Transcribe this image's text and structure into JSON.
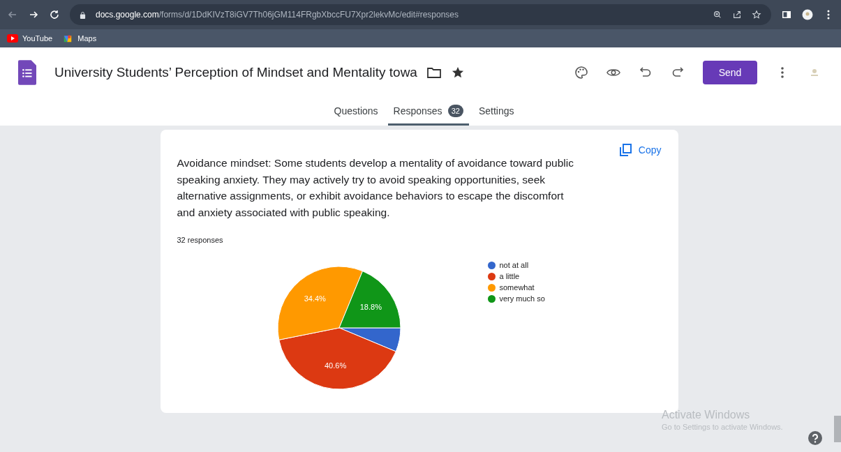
{
  "browser": {
    "url_host": "docs.google.com",
    "url_path": "/forms/d/1DdKIVzT8iGV7Th06jGM114FRgbXbccFU7Xpr2lekvMc/edit#responses"
  },
  "bookmarks": [
    {
      "label": "YouTube",
      "kind": "youtube"
    },
    {
      "label": "Maps",
      "kind": "maps"
    }
  ],
  "form": {
    "title": "University Students’ Perception of Mindset and Mentality towa",
    "send": "Send"
  },
  "tabs": [
    {
      "label": "Questions",
      "selected": false
    },
    {
      "label": "Responses",
      "selected": true,
      "count": "32"
    },
    {
      "label": "Settings",
      "selected": false
    }
  ],
  "question": {
    "text": "Avoidance mindset: Some students develop a mentality of avoidance toward public speaking anxiety. They may actively try to avoid speaking opportunities, seek alternative assignments, or exhibit avoidance behaviors to escape the discomfort and anxiety associated with public speaking.",
    "copy": "Copy",
    "responses": "32 responses",
    "chart_data": {
      "type": "pie",
      "categories": [
        "not at all",
        "a little",
        "somewhat",
        "very much so"
      ],
      "values": [
        6.3,
        40.6,
        34.4,
        18.8
      ],
      "legend": "right",
      "colors": [
        "#3366cc",
        "#dc3912",
        "#ff9900",
        "#109618"
      ],
      "value_labels": [
        null,
        "40.6%",
        "34.4%",
        "18.8%"
      ]
    }
  },
  "overlay": {
    "title": "Activate Windows",
    "subtitle": "Go to Settings to activate Windows."
  }
}
